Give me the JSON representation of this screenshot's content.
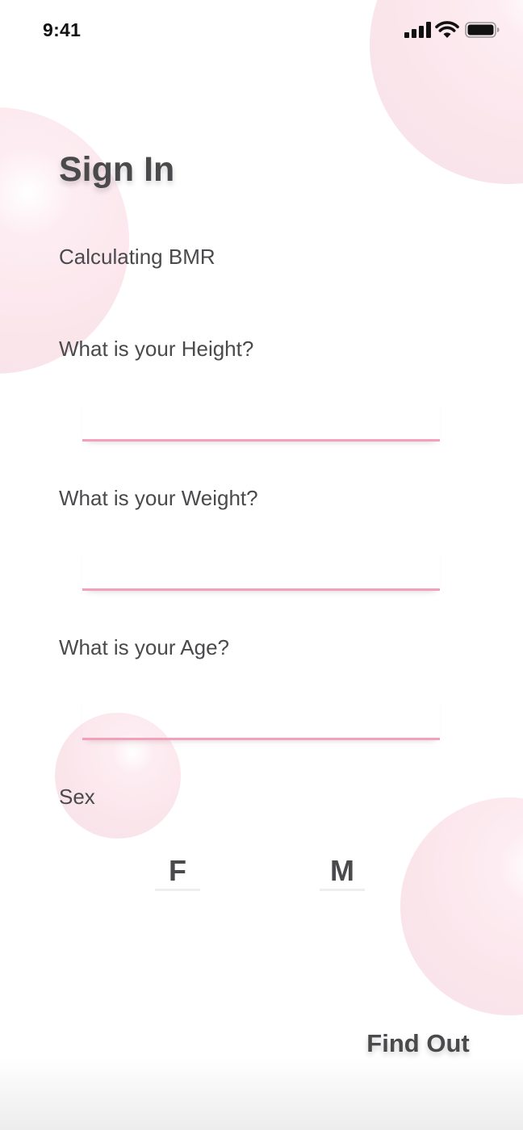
{
  "status_bar": {
    "time": "9:41",
    "icons": [
      "cellular-signal-icon",
      "wifi-icon",
      "battery-icon"
    ]
  },
  "page": {
    "title": "Sign In",
    "subtitle": "Calculating BMR"
  },
  "form": {
    "height": {
      "label": "What is your Height?",
      "value": ""
    },
    "weight": {
      "label": "What is your Weight?",
      "value": ""
    },
    "age": {
      "label": "What is your Age?",
      "value": ""
    },
    "sex": {
      "label": "Sex",
      "options": [
        "F",
        "M"
      ]
    }
  },
  "actions": {
    "submit_label": "Find Out"
  },
  "colors": {
    "accent_underline": "#f4a0bb",
    "bubble": "#fae2e9",
    "text": "#4a4a4d",
    "background": "#ffffff"
  }
}
